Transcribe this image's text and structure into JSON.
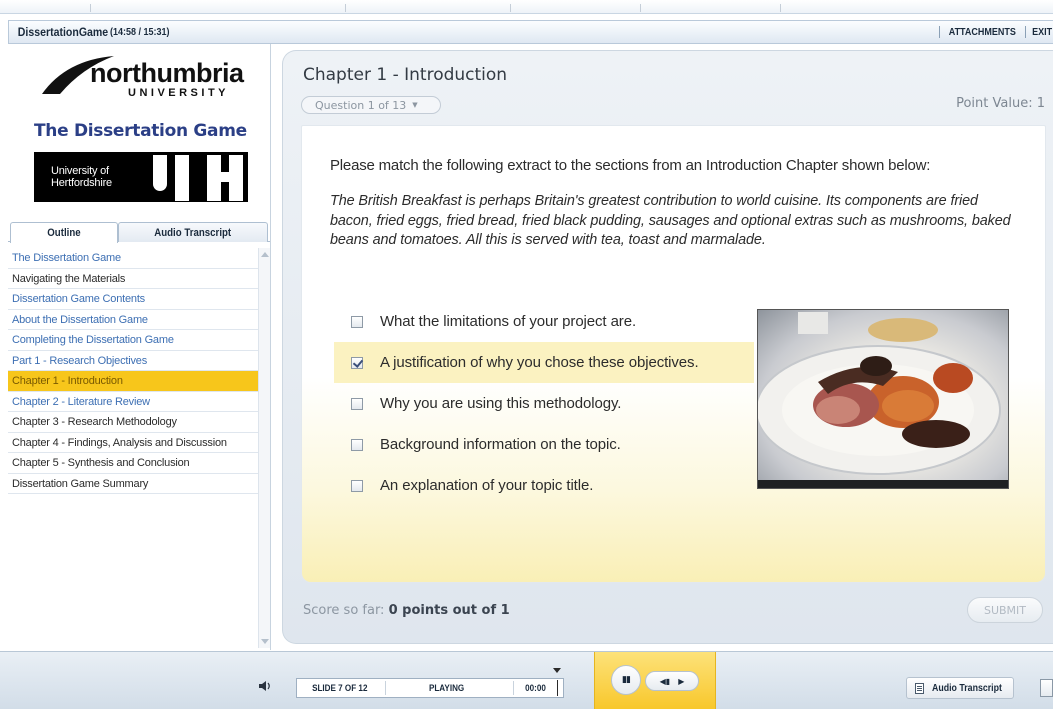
{
  "window": {
    "app_title": "DissertationGame",
    "timer": "(14:58 / 15:31)",
    "links": [
      "ATTACHMENTS",
      "EXIT"
    ]
  },
  "sidebar": {
    "logos": {
      "northumbria_word": "northumbria",
      "northumbria_sub": "UNIVERSITY",
      "course_title": "The Dissertation Game",
      "herts_line1": "University of",
      "herts_line2": "Hertfordshire"
    },
    "tabs": [
      {
        "label": "Outline",
        "active": true
      },
      {
        "label": "Audio Transcript",
        "active": false
      }
    ],
    "outline": [
      {
        "label": "The Dissertation Game",
        "state": "visited"
      },
      {
        "label": "Navigating the Materials",
        "state": "normal"
      },
      {
        "label": "Dissertation Game Contents",
        "state": "visited"
      },
      {
        "label": "About the Dissertation Game",
        "state": "visited"
      },
      {
        "label": "Completing the Dissertation Game",
        "state": "visited"
      },
      {
        "label": "Part 1 - Research Objectives",
        "state": "visited"
      },
      {
        "label": "Chapter 1 - Introduction",
        "state": "current"
      },
      {
        "label": "Chapter 2 - Literature Review",
        "state": "visited"
      },
      {
        "label": "Chapter 3 - Research Methodology",
        "state": "normal"
      },
      {
        "label": "Chapter 4 - Findings, Analysis and Discussion",
        "state": "normal"
      },
      {
        "label": "Chapter 5 - Synthesis and Conclusion",
        "state": "normal"
      },
      {
        "label": "Dissertation Game Summary",
        "state": "normal"
      }
    ]
  },
  "main": {
    "chapter_title": "Chapter 1 - Introduction",
    "question_indicator": "Question 1 of 13",
    "point_value": "Point Value:  1",
    "instruction": "Please match the following extract to the sections from an Introduction Chapter shown below:",
    "extract": "The British Breakfast is perhaps Britain's greatest contribution to world cuisine. Its components are fried bacon, fried eggs, fried bread, fried black pudding, sausages and optional extras such as mushrooms, baked beans and tomatoes. All this is served with tea, toast and marmalade.",
    "options": [
      {
        "label": "What the limitations of your project are.",
        "checked": false
      },
      {
        "label": "A justification of why you chose these objectives.",
        "checked": true
      },
      {
        "label": "Why you are using this methodology.",
        "checked": false
      },
      {
        "label": "Background information on the topic.",
        "checked": false
      },
      {
        "label": "An explanation of your topic title.",
        "checked": false
      }
    ],
    "score_label": "Score so far:",
    "score_value": "0 points out of 1",
    "submit_label": "SUBMIT"
  },
  "player": {
    "slide": "SLIDE 7 OF 12",
    "status": "PLAYING",
    "time": "00:00",
    "audio_transcript_label": "Audio Transcript"
  },
  "colors": {
    "current_item": "#f7c61b",
    "visited_link": "#3d6fb3",
    "course_title": "#2b3f86",
    "player_gold": "#f8c72a"
  }
}
